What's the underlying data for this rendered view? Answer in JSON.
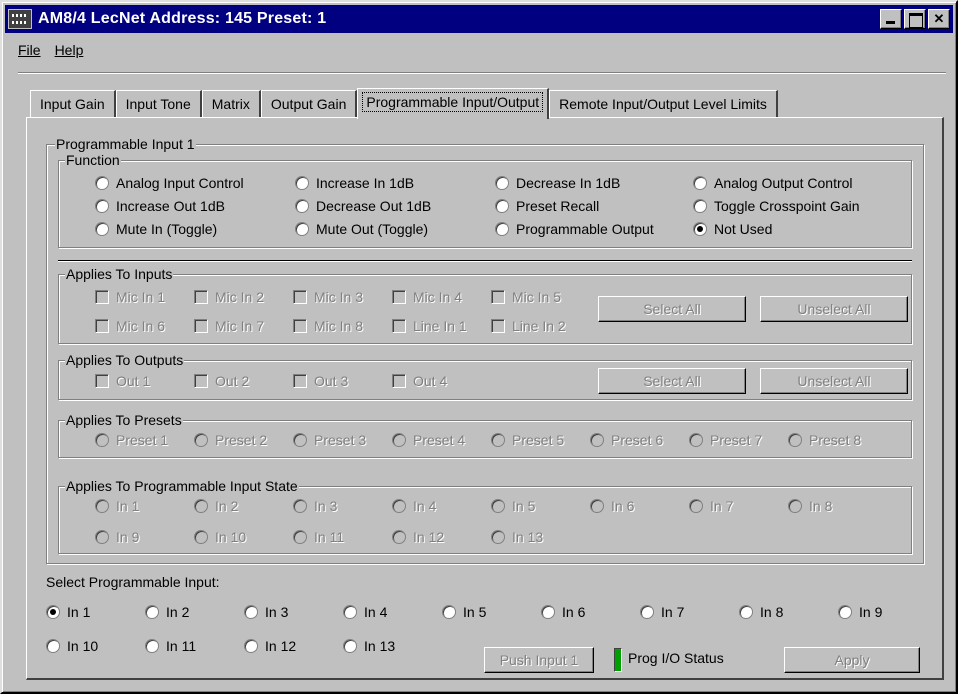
{
  "window": {
    "title": "AM8/4  LecNet Address: 145  Preset: 1"
  },
  "menu": {
    "file": "File",
    "help": "Help"
  },
  "tabs": [
    {
      "label": "Input  Gain",
      "active": false
    },
    {
      "label": "Input Tone",
      "active": false
    },
    {
      "label": "Matrix",
      "active": false
    },
    {
      "label": "Output Gain",
      "active": false
    },
    {
      "label": "Programmable Input/Output",
      "active": true
    },
    {
      "label": "Remote Input/Output Level Limits",
      "active": false
    }
  ],
  "prog_input": {
    "label": "Programmable Input 1",
    "function": {
      "label": "Function",
      "options": [
        "Analog Input Control",
        "Increase In 1dB",
        "Decrease In 1dB",
        "Analog Output Control",
        "Increase Out 1dB",
        "Decrease Out 1dB",
        "Preset Recall",
        "Toggle Crosspoint Gain",
        "Mute In (Toggle)",
        "Mute Out (Toggle)",
        "Programmable Output",
        "Not Used"
      ],
      "selected": "Not Used"
    },
    "applies_inputs": {
      "label": "Applies To Inputs",
      "items": [
        "Mic In 1",
        "Mic In 2",
        "Mic In 3",
        "Mic In 4",
        "Mic In 5",
        "Mic In 6",
        "Mic In 7",
        "Mic In 8",
        "Line In 1",
        "Line In 2"
      ],
      "select_all": "Select All",
      "unselect_all": "Unselect All"
    },
    "applies_outputs": {
      "label": "Applies To Outputs",
      "items": [
        "Out 1",
        "Out 2",
        "Out 3",
        "Out 4"
      ],
      "select_all": "Select All",
      "unselect_all": "Unselect All"
    },
    "applies_presets": {
      "label": "Applies To Presets",
      "items": [
        "Preset 1",
        "Preset 2",
        "Preset 3",
        "Preset 4",
        "Preset 5",
        "Preset 6",
        "Preset 7",
        "Preset 8"
      ]
    },
    "applies_state": {
      "label": "Applies To Programmable Input State",
      "items": [
        "In 1",
        "In 2",
        "In 3",
        "In 4",
        "In 5",
        "In 6",
        "In 7",
        "In 8",
        "In 9",
        "In 10",
        "In 11",
        "In 12",
        "In 13"
      ]
    }
  },
  "select_prog_input": {
    "label": "Select Programmable Input:",
    "items": [
      "In 1",
      "In 2",
      "In 3",
      "In 4",
      "In 5",
      "In 6",
      "In 7",
      "In 8",
      "In 9",
      "In 10",
      "In 11",
      "In 12",
      "In 13"
    ],
    "selected": "In 1"
  },
  "footer": {
    "push_input": "Push Input 1",
    "status_label": "Prog I/O Status",
    "status_color": "#00a000",
    "apply": "Apply"
  }
}
